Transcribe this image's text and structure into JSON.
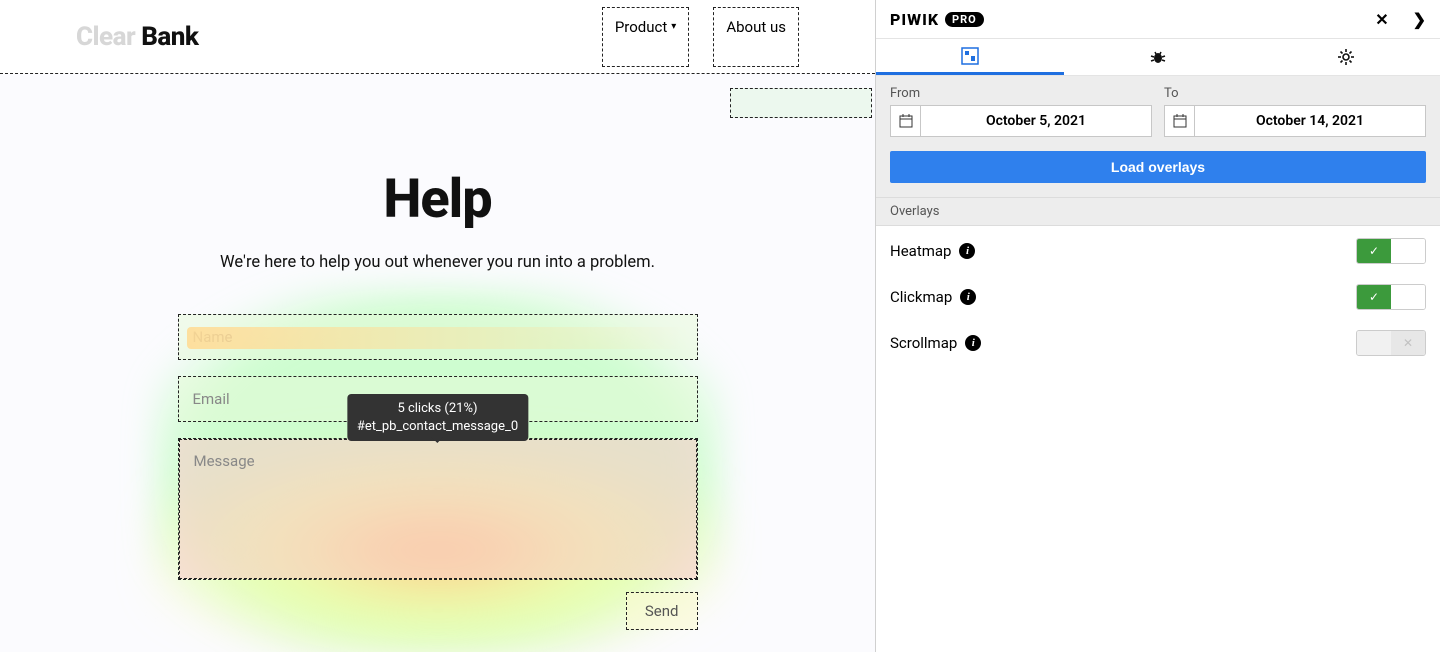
{
  "site": {
    "brand_dim": "Clear ",
    "brand_bold": "Bank",
    "nav": {
      "product": "Product",
      "about": "About us"
    },
    "hero": {
      "title": "Help",
      "subtitle": "We're here to help you out whenever you run into a problem."
    },
    "form": {
      "name_placeholder": "Name",
      "email_placeholder": "Email",
      "message_placeholder": "Message",
      "send_label": "Send"
    },
    "tooltip": {
      "line1": "5 clicks (21%)",
      "line2": "#et_pb_contact_message_0"
    }
  },
  "panel": {
    "logo": {
      "text": "PIWIK",
      "badge": "PRO"
    },
    "actions": {
      "close": "✕",
      "next": "❯"
    },
    "date": {
      "from_label": "From",
      "to_label": "To",
      "from_value": "October 5, 2021",
      "to_value": "October 14, 2021"
    },
    "load_button": "Load overlays",
    "overlays_label": "Overlays",
    "toggles": {
      "heatmap": "Heatmap",
      "clickmap": "Clickmap",
      "scrollmap": "Scrollmap",
      "check": "✓",
      "cross": "✕"
    }
  }
}
